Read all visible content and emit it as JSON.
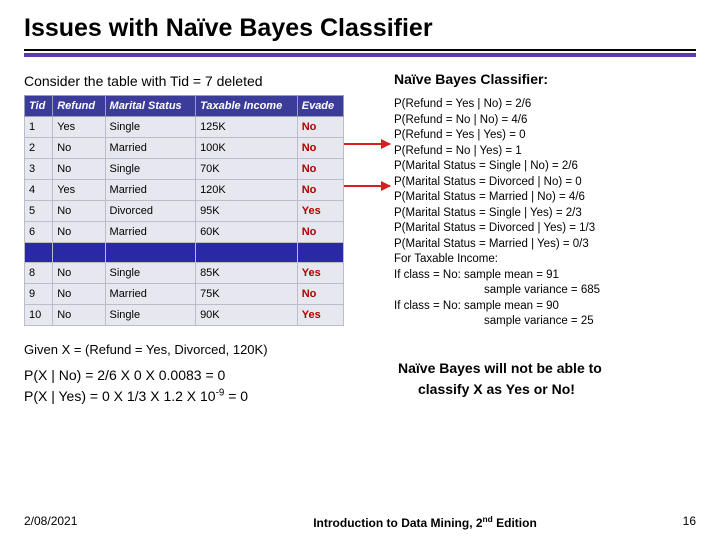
{
  "title": "Issues with Naïve Bayes Classifier",
  "intro_left": "Consider the table with Tid = 7 deleted",
  "intro_right": "Naïve  Bayes Classifier:",
  "table": {
    "headers": [
      "Tid",
      "Refund",
      "Marital Status",
      "Taxable Income",
      "Evade"
    ],
    "rows": [
      {
        "tid": "1",
        "refund": "Yes",
        "marital": "Single",
        "income": "125K",
        "evade": "No",
        "deleted": false
      },
      {
        "tid": "2",
        "refund": "No",
        "marital": "Married",
        "income": "100K",
        "evade": "No",
        "deleted": false
      },
      {
        "tid": "3",
        "refund": "No",
        "marital": "Single",
        "income": "70K",
        "evade": "No",
        "deleted": false
      },
      {
        "tid": "4",
        "refund": "Yes",
        "marital": "Married",
        "income": "120K",
        "evade": "No",
        "deleted": false
      },
      {
        "tid": "5",
        "refund": "No",
        "marital": "Divorced",
        "income": "95K",
        "evade": "Yes",
        "deleted": false
      },
      {
        "tid": "6",
        "refund": "No",
        "marital": "Married",
        "income": "60K",
        "evade": "No",
        "deleted": false
      },
      {
        "tid": "",
        "refund": "",
        "marital": "",
        "income": "",
        "evade": "",
        "deleted": true
      },
      {
        "tid": "8",
        "refund": "No",
        "marital": "Single",
        "income": "85K",
        "evade": "Yes",
        "deleted": false
      },
      {
        "tid": "9",
        "refund": "No",
        "marital": "Married",
        "income": "75K",
        "evade": "No",
        "deleted": false
      },
      {
        "tid": "10",
        "refund": "No",
        "marital": "Single",
        "income": "90K",
        "evade": "Yes",
        "deleted": false
      }
    ]
  },
  "probs": [
    "P(Refund = Yes | No) = 2/6",
    "P(Refund = No | No) = 4/6",
    "P(Refund = Yes | Yes) = 0",
    "P(Refund = No | Yes) = 1",
    "P(Marital Status = Single | No) = 2/6",
    "P(Marital Status = Divorced | No) = 0",
    "P(Marital Status = Married | No) = 4/6",
    "P(Marital Status = Single | Yes) = 2/3",
    "P(Marital Status = Divorced | Yes) = 1/3",
    "P(Marital Status = Married | Yes) = 0/3",
    "For Taxable Income:",
    "If class = No: sample mean = 91",
    "sample variance = 685",
    "If class = No: sample mean = 90",
    "sample variance = 25"
  ],
  "example_label": "Given X = (Refund = Yes, Divorced, 120K)",
  "calc1_pre": "P(X | No) = 2/6 X 0 X 0.0083 = 0",
  "calc2_pre": "P(X | Yes) = 0 X 1/3 X 1.2 X 10",
  "calc2_sup": "-9",
  "calc2_post": " = 0",
  "conclusion1": "Naïve Bayes will not be able to",
  "conclusion2": "classify X as Yes or No!",
  "footer": {
    "date": "2/08/2021",
    "center_pre": "Introduction to Data Mining, 2",
    "center_sup": "nd",
    "center_post": " Edition",
    "page": "16"
  }
}
